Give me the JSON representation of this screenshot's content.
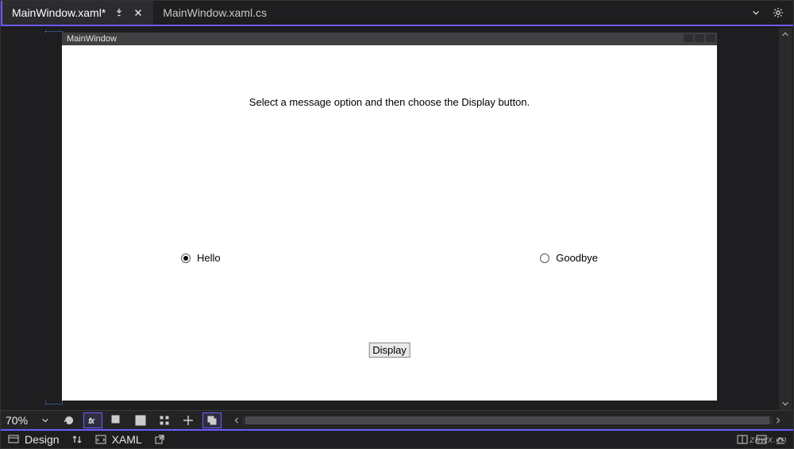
{
  "tabs": {
    "active": {
      "label": "MainWindow.xaml*"
    },
    "inactive": {
      "label": "MainWindow.xaml.cs"
    }
  },
  "designer": {
    "window_title": "MainWindow",
    "instruction_text": "Select a message option and then choose the Display button.",
    "radio_hello": {
      "label": "Hello",
      "selected": true
    },
    "radio_goodbye": {
      "label": "Goodbye",
      "selected": false
    },
    "display_button_label": "Display"
  },
  "toolbar": {
    "zoom": "70%"
  },
  "modes": {
    "design_label": "Design",
    "xaml_label": "XAML"
  },
  "icons": {
    "pin": "pin-icon",
    "close": "close-icon",
    "menu_caret": "caret-down-icon",
    "gear": "gear-icon",
    "refresh": "refresh-icon",
    "fx": "effects-icon",
    "grid": "grid-icon",
    "snap_grid": "snap-grid-icon",
    "snap_pixel": "snap-pixel-icon",
    "crosshair": "crosshair-icon",
    "group": "group-icon",
    "swap": "swap-panes-icon",
    "popout": "popout-icon",
    "split_h": "split-horizontal-icon",
    "split_v": "split-vertical-icon",
    "collapse": "collapse-pane-icon"
  },
  "watermark": "znwx.cn"
}
